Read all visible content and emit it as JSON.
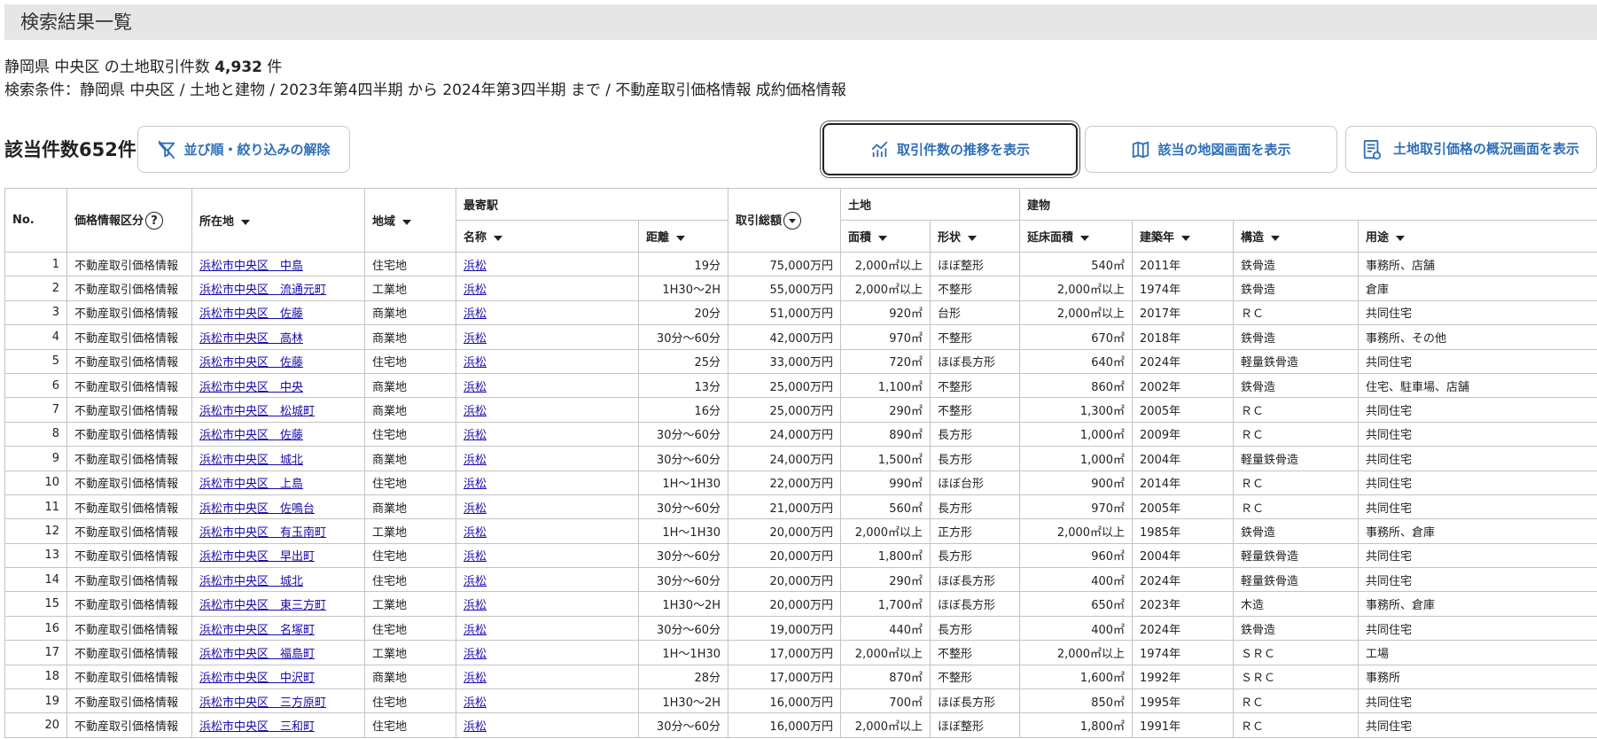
{
  "page_title": "検索結果一覧",
  "summary": {
    "line1_prefix": "静岡県 中央区 の土地取引件数",
    "line1_count": "4,932",
    "line1_suffix": "件",
    "line2": "検索条件：静岡県 中央区 / 土地と建物 / 2023年第4四半期 から 2024年第3四半期 まで / 不動産取引価格情報 成約価格情報"
  },
  "result_count": "該当件数652件",
  "buttons": {
    "clear": "並び順・絞り込みの解除",
    "trend": "取引件数の推移を表示",
    "map": "該当の地図画面を表示",
    "overview": "土地取引価格の概況画面を表示"
  },
  "table": {
    "headers": {
      "no": "No.",
      "price_type": "価格情報区分",
      "help_glyph": "?",
      "location": "所在地",
      "area_type": "地域",
      "station_group": "最寄駅",
      "station_name": "名称",
      "distance": "距離",
      "total": "取引総額",
      "land_group": "土地",
      "land_area": "面積",
      "shape": "形状",
      "building_group": "建物",
      "floor_area": "延床面積",
      "built_year": "建築年",
      "structure": "構造",
      "use": "用途"
    },
    "rows": [
      {
        "no": "1",
        "type": "不動産取引価格情報",
        "loc": "浜松市中央区　中島",
        "area": "住宅地",
        "station": "浜松",
        "dist": "19分",
        "total": "75,000万円",
        "land": "2,000㎡以上",
        "shape": "ほぼ整形",
        "floor": "540㎡",
        "year": "2011年",
        "struct": "鉄骨造",
        "use": "事務所、店舗"
      },
      {
        "no": "2",
        "type": "不動産取引価格情報",
        "loc": "浜松市中央区　流通元町",
        "area": "工業地",
        "station": "浜松",
        "dist": "1H30〜2H",
        "total": "55,000万円",
        "land": "2,000㎡以上",
        "shape": "不整形",
        "floor": "2,000㎡以上",
        "year": "1974年",
        "struct": "鉄骨造",
        "use": "倉庫"
      },
      {
        "no": "3",
        "type": "不動産取引価格情報",
        "loc": "浜松市中央区　佐藤",
        "area": "商業地",
        "station": "浜松",
        "dist": "20分",
        "total": "51,000万円",
        "land": "920㎡",
        "shape": "台形",
        "floor": "2,000㎡以上",
        "year": "2017年",
        "struct": "ＲＣ",
        "use": "共同住宅"
      },
      {
        "no": "4",
        "type": "不動産取引価格情報",
        "loc": "浜松市中央区　高林",
        "area": "商業地",
        "station": "浜松",
        "dist": "30分〜60分",
        "total": "42,000万円",
        "land": "970㎡",
        "shape": "不整形",
        "floor": "670㎡",
        "year": "2018年",
        "struct": "鉄骨造",
        "use": "事務所、その他"
      },
      {
        "no": "5",
        "type": "不動産取引価格情報",
        "loc": "浜松市中央区　佐藤",
        "area": "住宅地",
        "station": "浜松",
        "dist": "25分",
        "total": "33,000万円",
        "land": "720㎡",
        "shape": "ほぼ長方形",
        "floor": "640㎡",
        "year": "2024年",
        "struct": "軽量鉄骨造",
        "use": "共同住宅"
      },
      {
        "no": "6",
        "type": "不動産取引価格情報",
        "loc": "浜松市中央区　中央",
        "area": "商業地",
        "station": "浜松",
        "dist": "13分",
        "total": "25,000万円",
        "land": "1,100㎡",
        "shape": "不整形",
        "floor": "860㎡",
        "year": "2002年",
        "struct": "鉄骨造",
        "use": "住宅、駐車場、店舗"
      },
      {
        "no": "7",
        "type": "不動産取引価格情報",
        "loc": "浜松市中央区　松城町",
        "area": "商業地",
        "station": "浜松",
        "dist": "16分",
        "total": "25,000万円",
        "land": "290㎡",
        "shape": "不整形",
        "floor": "1,300㎡",
        "year": "2005年",
        "struct": "ＲＣ",
        "use": "共同住宅"
      },
      {
        "no": "8",
        "type": "不動産取引価格情報",
        "loc": "浜松市中央区　佐藤",
        "area": "住宅地",
        "station": "浜松",
        "dist": "30分〜60分",
        "total": "24,000万円",
        "land": "890㎡",
        "shape": "長方形",
        "floor": "1,000㎡",
        "year": "2009年",
        "struct": "ＲＣ",
        "use": "共同住宅"
      },
      {
        "no": "9",
        "type": "不動産取引価格情報",
        "loc": "浜松市中央区　城北",
        "area": "商業地",
        "station": "浜松",
        "dist": "30分〜60分",
        "total": "24,000万円",
        "land": "1,500㎡",
        "shape": "長方形",
        "floor": "1,000㎡",
        "year": "2004年",
        "struct": "軽量鉄骨造",
        "use": "共同住宅"
      },
      {
        "no": "10",
        "type": "不動産取引価格情報",
        "loc": "浜松市中央区　上島",
        "area": "住宅地",
        "station": "浜松",
        "dist": "1H〜1H30",
        "total": "22,000万円",
        "land": "990㎡",
        "shape": "ほぼ台形",
        "floor": "900㎡",
        "year": "2014年",
        "struct": "ＲＣ",
        "use": "共同住宅"
      },
      {
        "no": "11",
        "type": "不動産取引価格情報",
        "loc": "浜松市中央区　佐鳴台",
        "area": "商業地",
        "station": "浜松",
        "dist": "30分〜60分",
        "total": "21,000万円",
        "land": "560㎡",
        "shape": "長方形",
        "floor": "970㎡",
        "year": "2005年",
        "struct": "ＲＣ",
        "use": "共同住宅"
      },
      {
        "no": "12",
        "type": "不動産取引価格情報",
        "loc": "浜松市中央区　有玉南町",
        "area": "工業地",
        "station": "浜松",
        "dist": "1H〜1H30",
        "total": "20,000万円",
        "land": "2,000㎡以上",
        "shape": "正方形",
        "floor": "2,000㎡以上",
        "year": "1985年",
        "struct": "鉄骨造",
        "use": "事務所、倉庫"
      },
      {
        "no": "13",
        "type": "不動産取引価格情報",
        "loc": "浜松市中央区　早出町",
        "area": "住宅地",
        "station": "浜松",
        "dist": "30分〜60分",
        "total": "20,000万円",
        "land": "1,800㎡",
        "shape": "長方形",
        "floor": "960㎡",
        "year": "2004年",
        "struct": "軽量鉄骨造",
        "use": "共同住宅"
      },
      {
        "no": "14",
        "type": "不動産取引価格情報",
        "loc": "浜松市中央区　城北",
        "area": "住宅地",
        "station": "浜松",
        "dist": "30分〜60分",
        "total": "20,000万円",
        "land": "290㎡",
        "shape": "ほぼ長方形",
        "floor": "400㎡",
        "year": "2024年",
        "struct": "軽量鉄骨造",
        "use": "共同住宅"
      },
      {
        "no": "15",
        "type": "不動産取引価格情報",
        "loc": "浜松市中央区　東三方町",
        "area": "工業地",
        "station": "浜松",
        "dist": "1H30〜2H",
        "total": "20,000万円",
        "land": "1,700㎡",
        "shape": "ほぼ長方形",
        "floor": "650㎡",
        "year": "2023年",
        "struct": "木造",
        "use": "事務所、倉庫"
      },
      {
        "no": "16",
        "type": "不動産取引価格情報",
        "loc": "浜松市中央区　名塚町",
        "area": "住宅地",
        "station": "浜松",
        "dist": "30分〜60分",
        "total": "19,000万円",
        "land": "440㎡",
        "shape": "長方形",
        "floor": "400㎡",
        "year": "2024年",
        "struct": "鉄骨造",
        "use": "共同住宅"
      },
      {
        "no": "17",
        "type": "不動産取引価格情報",
        "loc": "浜松市中央区　福島町",
        "area": "工業地",
        "station": "浜松",
        "dist": "1H〜1H30",
        "total": "17,000万円",
        "land": "2,000㎡以上",
        "shape": "不整形",
        "floor": "2,000㎡以上",
        "year": "1974年",
        "struct": "ＳＲＣ",
        "use": "工場"
      },
      {
        "no": "18",
        "type": "不動産取引価格情報",
        "loc": "浜松市中央区　中沢町",
        "area": "商業地",
        "station": "浜松",
        "dist": "28分",
        "total": "17,000万円",
        "land": "870㎡",
        "shape": "不整形",
        "floor": "1,600㎡",
        "year": "1992年",
        "struct": "ＳＲＣ",
        "use": "事務所"
      },
      {
        "no": "19",
        "type": "不動産取引価格情報",
        "loc": "浜松市中央区　三方原町",
        "area": "住宅地",
        "station": "浜松",
        "dist": "1H30〜2H",
        "total": "16,000万円",
        "land": "700㎡",
        "shape": "ほぼ長方形",
        "floor": "850㎡",
        "year": "1995年",
        "struct": "ＲＣ",
        "use": "共同住宅"
      },
      {
        "no": "20",
        "type": "不動産取引価格情報",
        "loc": "浜松市中央区　三和町",
        "area": "住宅地",
        "station": "浜松",
        "dist": "30分〜60分",
        "total": "16,000万円",
        "land": "2,000㎡以上",
        "shape": "ほぼ整形",
        "floor": "1,800㎡",
        "year": "1991年",
        "struct": "ＲＣ",
        "use": "共同住宅"
      }
    ]
  },
  "colors": {
    "accent": "#2f6fb8",
    "link": "#1a0dab",
    "header_bg": "#e6e6e6",
    "border": "#c4c4c4"
  },
  "icons": {
    "clear": "filter-clear-icon",
    "trend": "chart-trend-icon",
    "map": "map-icon",
    "overview": "report-icon",
    "help": "help-circle-icon",
    "sort": "caret-down-icon",
    "sort_circle": "circle-caret-down-icon"
  }
}
